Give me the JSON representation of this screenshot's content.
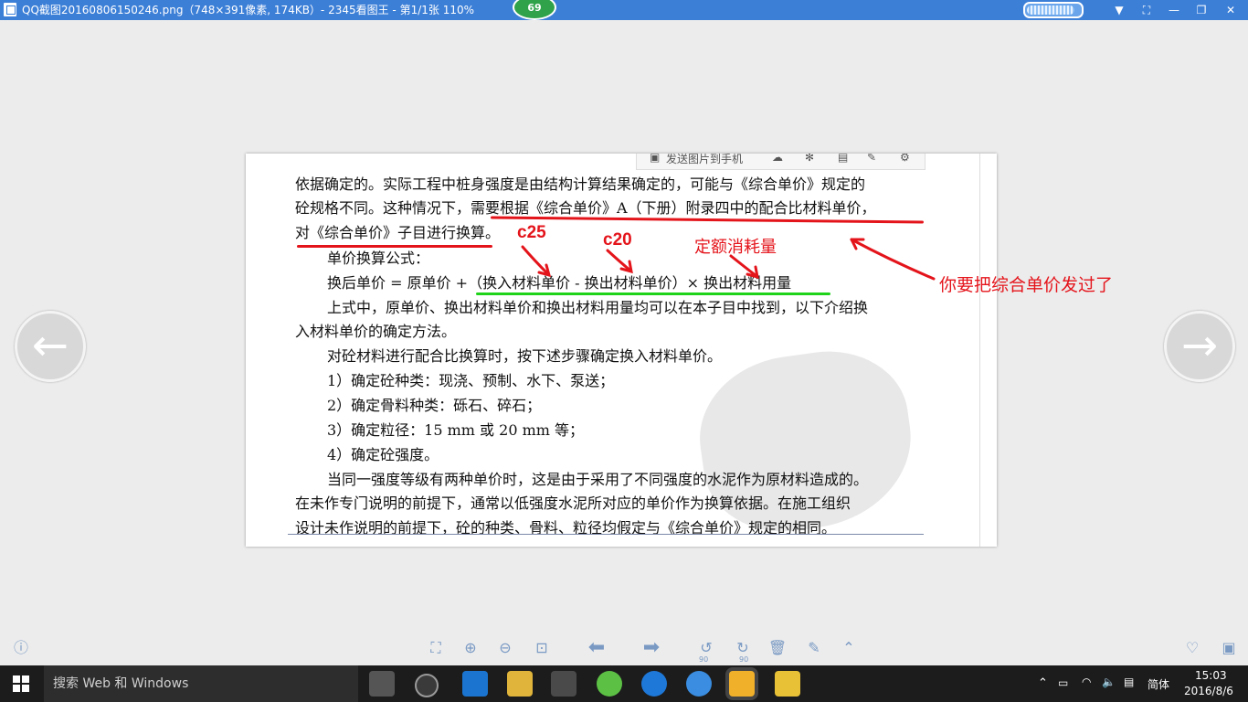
{
  "window": {
    "title": "QQ截图20160806150246.png（748×391像素, 174KB）- 2345看图王 - 第1/1张 110%",
    "badge_count": "69",
    "progress_fraction": 0.9
  },
  "inner_toolbar": {
    "send_to_phone": "发送图片到手机"
  },
  "document": {
    "lines": [
      "依据确定的。实际工程中桩身强度是由结构计算结果确定的，可能与《综合单价》规定的",
      "砼规格不同。这种情况下，需要根据《综合单价》A（下册）附录四中的配合比材料单价，",
      "对《综合单价》子目进行换算。",
      "单价换算公式：",
      "换后单价 = 原单价 +（换入材料单价 - 换出材料单价）× 换出材料用量",
      "上式中，原单价、换出材料单价和换出材料用量均可以在本子目中找到，以下介绍换",
      "入材料单价的确定方法。",
      "对砼材料进行配合比换算时，按下述步骤确定换入材料单价。",
      "1）确定砼种类：现浇、预制、水下、泵送；",
      "2）确定骨料种类：砾石、碎石；",
      "3）确定粒径：15 mm 或 20 mm 等；",
      "4）确定砼强度。",
      "当同一强度等级有两种单价时，这是由于采用了不同强度的水泥作为原材料造成的。",
      "在未作专门说明的前提下，通常以低强度水泥所对应的单价作为换算依据。在施工组织",
      "设计未作说明的前提下，砼的种类、骨料、粒径均假定与《综合单价》规定的相同。"
    ]
  },
  "annotations": {
    "c25": "c25",
    "c20": "c20",
    "quota": "定额消耗量",
    "note": "你要把综合单价发过了",
    "color_red": "#e4141b",
    "color_green": "#1fd21a"
  },
  "taskbar": {
    "search_placeholder": "搜索 Web 和 Windows",
    "ime": "简体",
    "time": "15:03",
    "date": "2016/8/6"
  },
  "icons": {
    "prev": "arrow-left-icon",
    "next": "arrow-right-icon",
    "rotate_left_label": "90",
    "rotate_right_label": "90"
  }
}
